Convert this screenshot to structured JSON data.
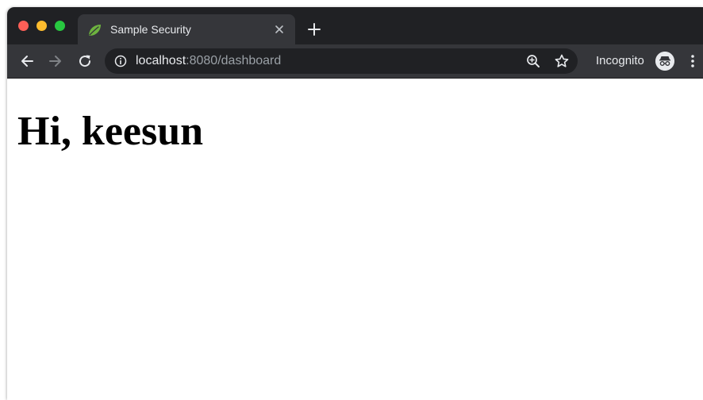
{
  "tab": {
    "title": "Sample Security",
    "favicon": "spring-leaf-icon"
  },
  "address_bar": {
    "host": "localhost",
    "path": ":8080/dashboard"
  },
  "profile": {
    "label": "Incognito"
  },
  "page": {
    "heading": "Hi, keesun"
  },
  "icons": {
    "back": "back-arrow-icon",
    "forward": "forward-arrow-icon",
    "reload": "reload-icon",
    "info": "info-icon",
    "zoom": "zoom-icon",
    "bookmark": "star-icon",
    "menu": "kebab-menu-icon"
  },
  "colors": {
    "tabstrip": "#202124",
    "toolbar": "#35363a",
    "omnibox": "#202124",
    "favicon": "#6db33f",
    "traffic_red": "#fe5f57",
    "traffic_yellow": "#febc2e",
    "traffic_green": "#28c840"
  }
}
